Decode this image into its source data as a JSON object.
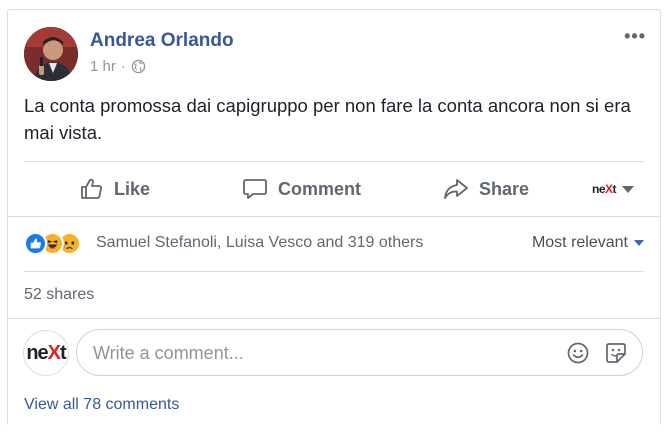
{
  "post": {
    "author": "Andrea Orlando",
    "time": "1 hr",
    "separator": "·",
    "privacy_icon": "globe-icon",
    "more_icon": "•••",
    "text": "La conta promossa dai capigruppo per non fare la conta ancora non si era mai vista."
  },
  "actions": {
    "like": "Like",
    "comment": "Comment",
    "share": "Share",
    "page_switch_prefix": "ne",
    "page_switch_x": "X",
    "page_switch_suffix": "t"
  },
  "reactions": {
    "icons": [
      "like-icon",
      "haha-icon",
      "sad-icon"
    ],
    "colors": {
      "like": "#1877f2",
      "haha": "#f7b125",
      "sad": "#f7b125"
    },
    "summary": "Samuel Stefanoli, Luisa Vesco and 319 others",
    "sort_label": "Most relevant"
  },
  "shares": "52 shares",
  "comment_composer": {
    "avatar_prefix": "ne",
    "avatar_x": "X",
    "avatar_suffix": "t",
    "placeholder": "Write a comment...",
    "emoji_icon": "smiley-icon",
    "sticker_icon": "sticker-icon"
  },
  "view_all_comments": "View all 78 comments",
  "colors": {
    "link_blue": "#365899",
    "muted_text": "#606770",
    "border": "#dddfe2",
    "accent_red": "#e02020"
  }
}
